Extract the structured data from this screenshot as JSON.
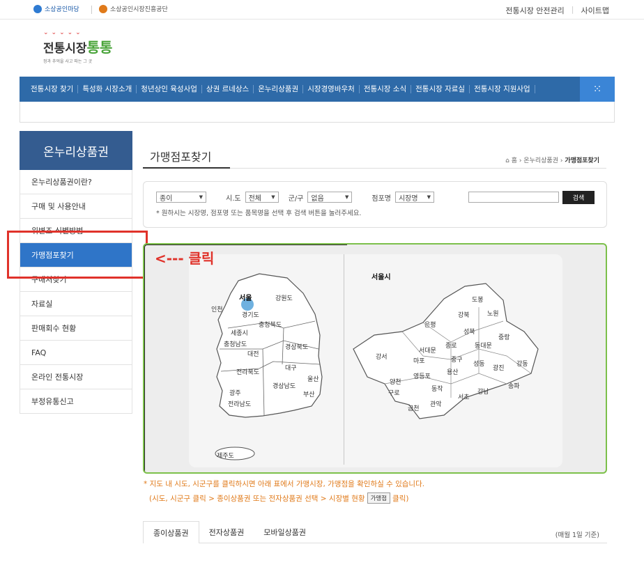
{
  "util": {
    "logo1": "소상공인마당",
    "logo2": "소상공인시장진흥공단",
    "links": [
      "전통시장 안전관리",
      "사이트맵"
    ]
  },
  "site_logo": {
    "title_a": "전통시장",
    "title_b": "통통",
    "tagline": "정과 추억을 사고 파는 그 곳"
  },
  "gnb": {
    "items": [
      "전통시장 찾기",
      "특성화 시장소개",
      "청년상인 육성사업",
      "상권 르네상스",
      "온누리상품권",
      "시장경영바우처",
      "전통시장 소식",
      "전통시장 자료실",
      "전통시장 지원사업"
    ],
    "grid_icon": "grid-menu-icon"
  },
  "lnb": {
    "title": "온누리상품권",
    "items": [
      "온누리상품권이란?",
      "구매 및 사용안내",
      "위변조 식별방법",
      "가맹점포찾기",
      "구매처찾기",
      "자료실",
      "판매회수 현황",
      "FAQ",
      "온라인 전통시장",
      "부정유통신고"
    ],
    "active_index": 3
  },
  "content": {
    "title": "가맹점포찾기",
    "breadcrumb": [
      "홈",
      "온누리상품권",
      "가맹점포찾기"
    ]
  },
  "search": {
    "type_select": "종이",
    "sido_label": "시.도",
    "sido_select": "전체",
    "gugun_label": "군/구",
    "gugun_select": "없음",
    "store_label": "점포명",
    "store_select": "시장명",
    "keyword_value": "",
    "button": "검색",
    "note": "* 원하시는 시장명, 점포명 또는 품목명을 선택 후 검색 버튼을 눌러주세요."
  },
  "annotation": {
    "text": "<--- 클릭",
    "color": "#e0322a"
  },
  "map": {
    "korea_labels": [
      "서울",
      "인천",
      "강원도",
      "경기도",
      "충청북도",
      "세종시",
      "충청남도",
      "대전",
      "경상북도",
      "대구",
      "전라북도",
      "경상남도",
      "울산",
      "광주",
      "부산",
      "전라남도",
      "제주도"
    ],
    "seoul_title": "서울시",
    "seoul_labels": [
      "도봉",
      "강북",
      "노원",
      "은평",
      "성북",
      "중랑",
      "종로",
      "동대문",
      "서대문",
      "중구",
      "강서",
      "마포",
      "성동",
      "광진",
      "강동",
      "용산",
      "영등포",
      "양천",
      "동작",
      "구로",
      "송파",
      "강남",
      "서초",
      "금천",
      "관악"
    ]
  },
  "notice": {
    "line1": "* 지도 내 시도, 시군구를 클릭하시면 아래 표에서 가맹시장, 가맹점을 확인하실 수 있습니다.",
    "line2_a": "(시도, 시군구 클릭 > 종이상품권 또는 전자상품권 선택 > 시장별 현황",
    "line2_btn": "가맹점",
    "line2_b": "클릭)"
  },
  "tabs": {
    "items": [
      "종이상품권",
      "전자상품권",
      "모바일상품권"
    ],
    "active_index": 0,
    "base_date": "(매월 1일 기준)"
  },
  "colors": {
    "nav_blue": "#2e6aa8",
    "lnb_head": "#345c90",
    "active_menu": "#2f75c8",
    "highlight_red": "#e0322a",
    "notice_orange": "#e07a1a",
    "map_border_green": "#7cc04a"
  }
}
